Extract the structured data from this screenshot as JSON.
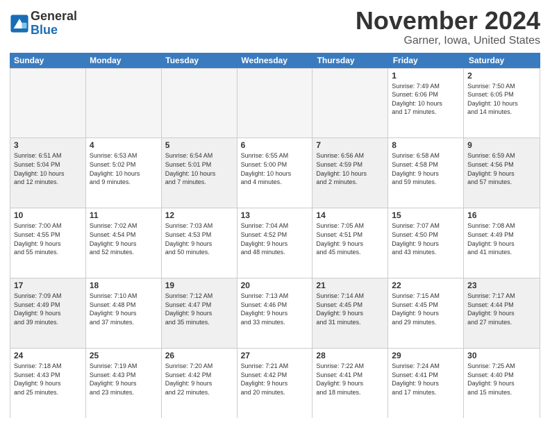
{
  "logo": {
    "general": "General",
    "blue": "Blue"
  },
  "title": "November 2024",
  "location": "Garner, Iowa, United States",
  "days_of_week": [
    "Sunday",
    "Monday",
    "Tuesday",
    "Wednesday",
    "Thursday",
    "Friday",
    "Saturday"
  ],
  "weeks": [
    [
      {
        "day": "",
        "info": "",
        "empty": true
      },
      {
        "day": "",
        "info": "",
        "empty": true
      },
      {
        "day": "",
        "info": "",
        "empty": true
      },
      {
        "day": "",
        "info": "",
        "empty": true
      },
      {
        "day": "",
        "info": "",
        "empty": true
      },
      {
        "day": "1",
        "info": "Sunrise: 7:49 AM\nSunset: 6:06 PM\nDaylight: 10 hours\nand 17 minutes."
      },
      {
        "day": "2",
        "info": "Sunrise: 7:50 AM\nSunset: 6:05 PM\nDaylight: 10 hours\nand 14 minutes."
      }
    ],
    [
      {
        "day": "3",
        "info": "Sunrise: 6:51 AM\nSunset: 5:04 PM\nDaylight: 10 hours\nand 12 minutes."
      },
      {
        "day": "4",
        "info": "Sunrise: 6:53 AM\nSunset: 5:02 PM\nDaylight: 10 hours\nand 9 minutes."
      },
      {
        "day": "5",
        "info": "Sunrise: 6:54 AM\nSunset: 5:01 PM\nDaylight: 10 hours\nand 7 minutes."
      },
      {
        "day": "6",
        "info": "Sunrise: 6:55 AM\nSunset: 5:00 PM\nDaylight: 10 hours\nand 4 minutes."
      },
      {
        "day": "7",
        "info": "Sunrise: 6:56 AM\nSunset: 4:59 PM\nDaylight: 10 hours\nand 2 minutes."
      },
      {
        "day": "8",
        "info": "Sunrise: 6:58 AM\nSunset: 4:58 PM\nDaylight: 9 hours\nand 59 minutes."
      },
      {
        "day": "9",
        "info": "Sunrise: 6:59 AM\nSunset: 4:56 PM\nDaylight: 9 hours\nand 57 minutes."
      }
    ],
    [
      {
        "day": "10",
        "info": "Sunrise: 7:00 AM\nSunset: 4:55 PM\nDaylight: 9 hours\nand 55 minutes."
      },
      {
        "day": "11",
        "info": "Sunrise: 7:02 AM\nSunset: 4:54 PM\nDaylight: 9 hours\nand 52 minutes."
      },
      {
        "day": "12",
        "info": "Sunrise: 7:03 AM\nSunset: 4:53 PM\nDaylight: 9 hours\nand 50 minutes."
      },
      {
        "day": "13",
        "info": "Sunrise: 7:04 AM\nSunset: 4:52 PM\nDaylight: 9 hours\nand 48 minutes."
      },
      {
        "day": "14",
        "info": "Sunrise: 7:05 AM\nSunset: 4:51 PM\nDaylight: 9 hours\nand 45 minutes."
      },
      {
        "day": "15",
        "info": "Sunrise: 7:07 AM\nSunset: 4:50 PM\nDaylight: 9 hours\nand 43 minutes."
      },
      {
        "day": "16",
        "info": "Sunrise: 7:08 AM\nSunset: 4:49 PM\nDaylight: 9 hours\nand 41 minutes."
      }
    ],
    [
      {
        "day": "17",
        "info": "Sunrise: 7:09 AM\nSunset: 4:49 PM\nDaylight: 9 hours\nand 39 minutes."
      },
      {
        "day": "18",
        "info": "Sunrise: 7:10 AM\nSunset: 4:48 PM\nDaylight: 9 hours\nand 37 minutes."
      },
      {
        "day": "19",
        "info": "Sunrise: 7:12 AM\nSunset: 4:47 PM\nDaylight: 9 hours\nand 35 minutes."
      },
      {
        "day": "20",
        "info": "Sunrise: 7:13 AM\nSunset: 4:46 PM\nDaylight: 9 hours\nand 33 minutes."
      },
      {
        "day": "21",
        "info": "Sunrise: 7:14 AM\nSunset: 4:45 PM\nDaylight: 9 hours\nand 31 minutes."
      },
      {
        "day": "22",
        "info": "Sunrise: 7:15 AM\nSunset: 4:45 PM\nDaylight: 9 hours\nand 29 minutes."
      },
      {
        "day": "23",
        "info": "Sunrise: 7:17 AM\nSunset: 4:44 PM\nDaylight: 9 hours\nand 27 minutes."
      }
    ],
    [
      {
        "day": "24",
        "info": "Sunrise: 7:18 AM\nSunset: 4:43 PM\nDaylight: 9 hours\nand 25 minutes."
      },
      {
        "day": "25",
        "info": "Sunrise: 7:19 AM\nSunset: 4:43 PM\nDaylight: 9 hours\nand 23 minutes."
      },
      {
        "day": "26",
        "info": "Sunrise: 7:20 AM\nSunset: 4:42 PM\nDaylight: 9 hours\nand 22 minutes."
      },
      {
        "day": "27",
        "info": "Sunrise: 7:21 AM\nSunset: 4:42 PM\nDaylight: 9 hours\nand 20 minutes."
      },
      {
        "day": "28",
        "info": "Sunrise: 7:22 AM\nSunset: 4:41 PM\nDaylight: 9 hours\nand 18 minutes."
      },
      {
        "day": "29",
        "info": "Sunrise: 7:24 AM\nSunset: 4:41 PM\nDaylight: 9 hours\nand 17 minutes."
      },
      {
        "day": "30",
        "info": "Sunrise: 7:25 AM\nSunset: 4:40 PM\nDaylight: 9 hours\nand 15 minutes."
      }
    ]
  ]
}
